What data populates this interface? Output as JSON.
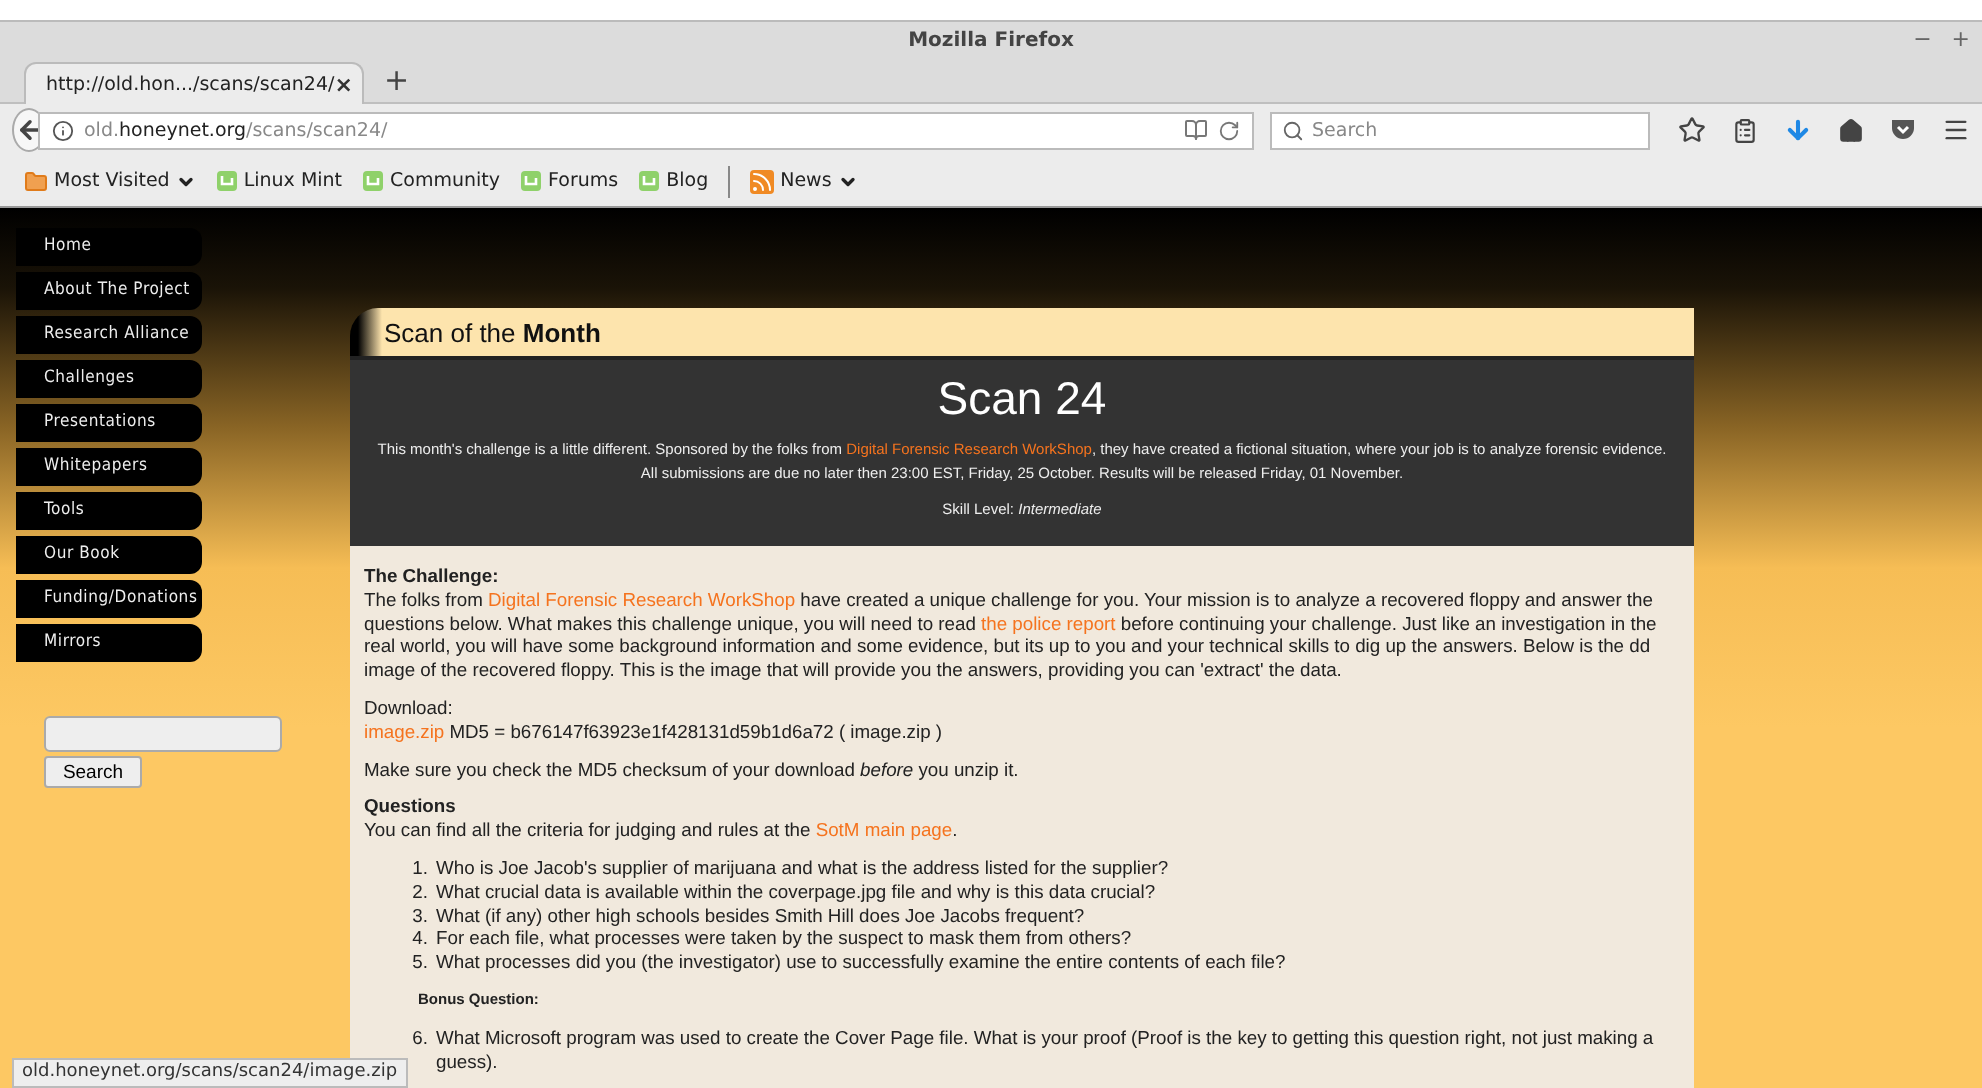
{
  "window": {
    "title": "Mozilla Firefox",
    "controls": [
      "−",
      "+"
    ]
  },
  "tabs": [
    {
      "label": "http://old.hon.../scans/scan24/",
      "selected": true,
      "close": "×"
    }
  ],
  "new_tab": "+",
  "address_bar": {
    "prefix": "old.",
    "host": "honeynet.org",
    "path": "/scans/scan24/"
  },
  "search": {
    "placeholder": "Search"
  },
  "bookmarks": [
    {
      "label": "Most Visited",
      "kind": "folder",
      "dropdown": true
    },
    {
      "label": "Linux Mint",
      "kind": "site",
      "dropdown": false
    },
    {
      "label": "Community",
      "kind": "site",
      "dropdown": false
    },
    {
      "label": "Forums",
      "kind": "site",
      "dropdown": false
    },
    {
      "label": "Blog",
      "kind": "site",
      "dropdown": false
    },
    {
      "label": "News",
      "kind": "feed",
      "dropdown": true
    }
  ],
  "sidebar": {
    "items": [
      "Home",
      "About The Project",
      "Research Alliance",
      "Challenges",
      "Presentations",
      "Whitepapers",
      "Tools",
      "Our Book",
      "Funding/Donations",
      "Mirrors"
    ],
    "search_button": "Search"
  },
  "panel": {
    "header_light": "Scan of the",
    "header_bold": "Month",
    "title": "Scan 24",
    "intro": [
      {
        "text": "This month's challenge is a little different. Sponsored by the folks from ",
        "link": false
      },
      {
        "text": "Digital Forensic Research WorkShop",
        "link": true
      },
      {
        "text": ", they have created a fictional situation, where your job is to analyze forensic evidence. All submissions are due no later then 23:00 EST, Friday, 25 October. Results will be released Friday, 01 November.",
        "link": false
      }
    ],
    "skill": "Skill Level: *Intermediate*"
  },
  "challenge": {
    "heading": "The Challenge:",
    "paragraph": [
      {
        "text": "The folks from ",
        "link": false
      },
      {
        "text": "Digital Forensic Research WorkShop",
        "link": true
      },
      {
        "text": " have created a unique challenge for you. Your mission is to analyze a recovered floppy and answer the questions below. What makes this challenge unique, you will need to read ",
        "link": false
      },
      {
        "text": "the police report",
        "link": true
      },
      {
        "text": " before continuing your challenge. Just like an investigation in the real world, you will have some background information and some evidence, but its up to you and your technical skills to dig up the answers. Below is the dd image of the recovered floppy. This is the image that will provide you the answers, providing you can 'extract' the data.",
        "link": false
      }
    ]
  },
  "download": {
    "label": "Download:",
    "line": [
      {
        "text": "image.zip",
        "link": true
      },
      {
        "text": " MD5 = b676147f63923e1f428131d59b1d6a72 ( image.zip )",
        "link": false
      }
    ]
  },
  "md5_note": "Make sure you check the MD5 checksum of your download *before* you unzip it.",
  "questions": {
    "heading": "Questions",
    "intro": [
      {
        "text": "You can find all the criteria for judging and rules at the ",
        "link": false
      },
      {
        "text": "SotM main page",
        "link": true
      },
      {
        "text": ".",
        "link": false
      }
    ],
    "items": [
      {
        "number": "1.",
        "text": "Who is Joe Jacob's supplier of marijuana and what is the address listed for the supplier?"
      },
      {
        "number": "2.",
        "text": "What crucial data is available within the coverpage.jpg file and why is this data crucial?"
      },
      {
        "number": "3.",
        "text": "What (if any) other high schools besides Smith Hill does Joe Jacobs frequent?"
      },
      {
        "number": "4.",
        "text": "For each file, what processes were taken by the suspect to mask them from others?"
      },
      {
        "number": "5.",
        "text": "What processes did you (the investigator) use to successfully examine the entire contents of each file?"
      }
    ],
    "bonus_heading": "Bonus Question:",
    "bonus_items": [
      {
        "number": "6.",
        "text": "What Microsoft program was used to create the Cover Page file. What is your proof (Proof is the key to getting this question right, not just making a guess)."
      }
    ]
  },
  "status_bar": "old.honeynet.org/scans/scan24/image.zip"
}
